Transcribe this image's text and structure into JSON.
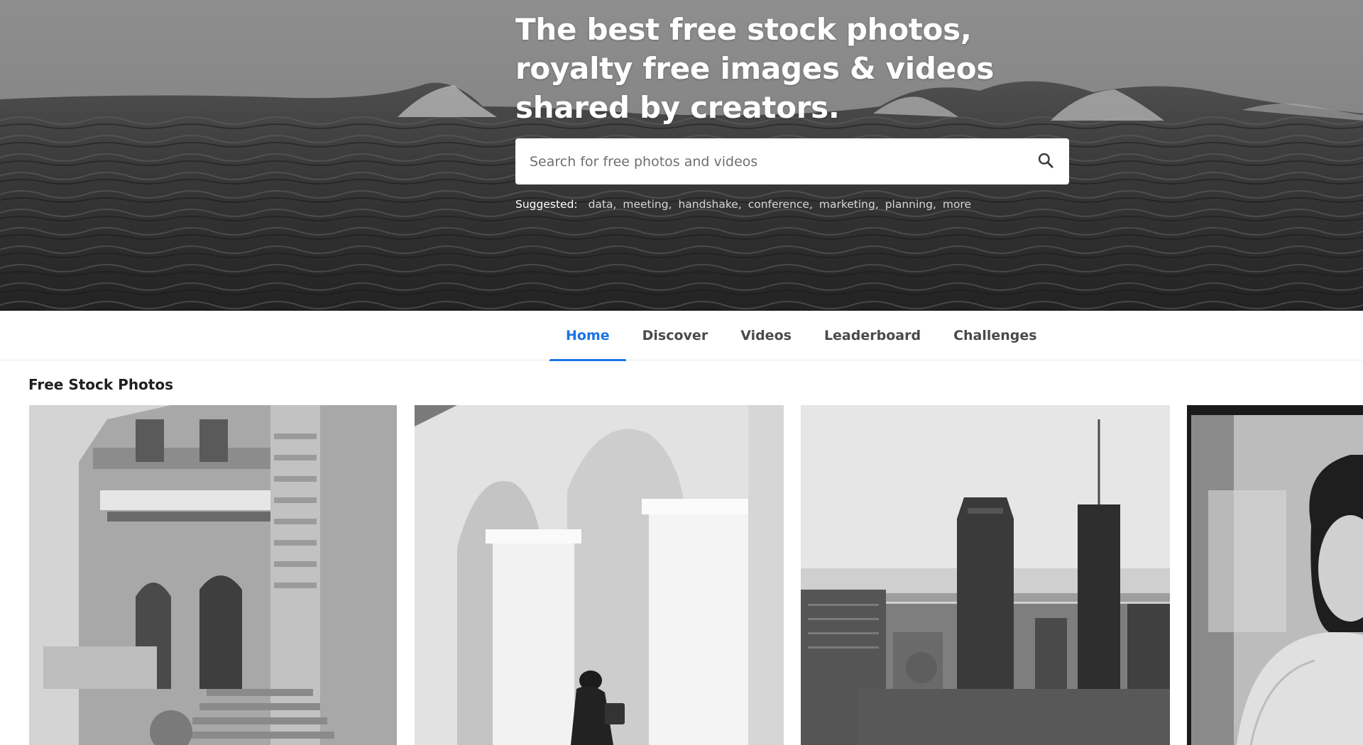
{
  "hero": {
    "title": "The best free stock photos, royalty free images & videos shared by creators."
  },
  "search": {
    "placeholder": "Search for free photos and videos",
    "icon": "search-icon"
  },
  "suggested": {
    "label": "Suggested:",
    "terms": [
      "data",
      "meeting",
      "handshake",
      "conference",
      "marketing",
      "planning",
      "more"
    ]
  },
  "nav": {
    "tabs": [
      {
        "label": "Home",
        "active": true
      },
      {
        "label": "Discover",
        "active": false
      },
      {
        "label": "Videos",
        "active": false
      },
      {
        "label": "Leaderboard",
        "active": false
      },
      {
        "label": "Challenges",
        "active": false
      }
    ]
  },
  "section": {
    "title": "Free Stock Photos"
  },
  "colors": {
    "accent": "#1a73e8",
    "nav_text": "#4a4a4a",
    "title_text": "#1f1f1f"
  }
}
